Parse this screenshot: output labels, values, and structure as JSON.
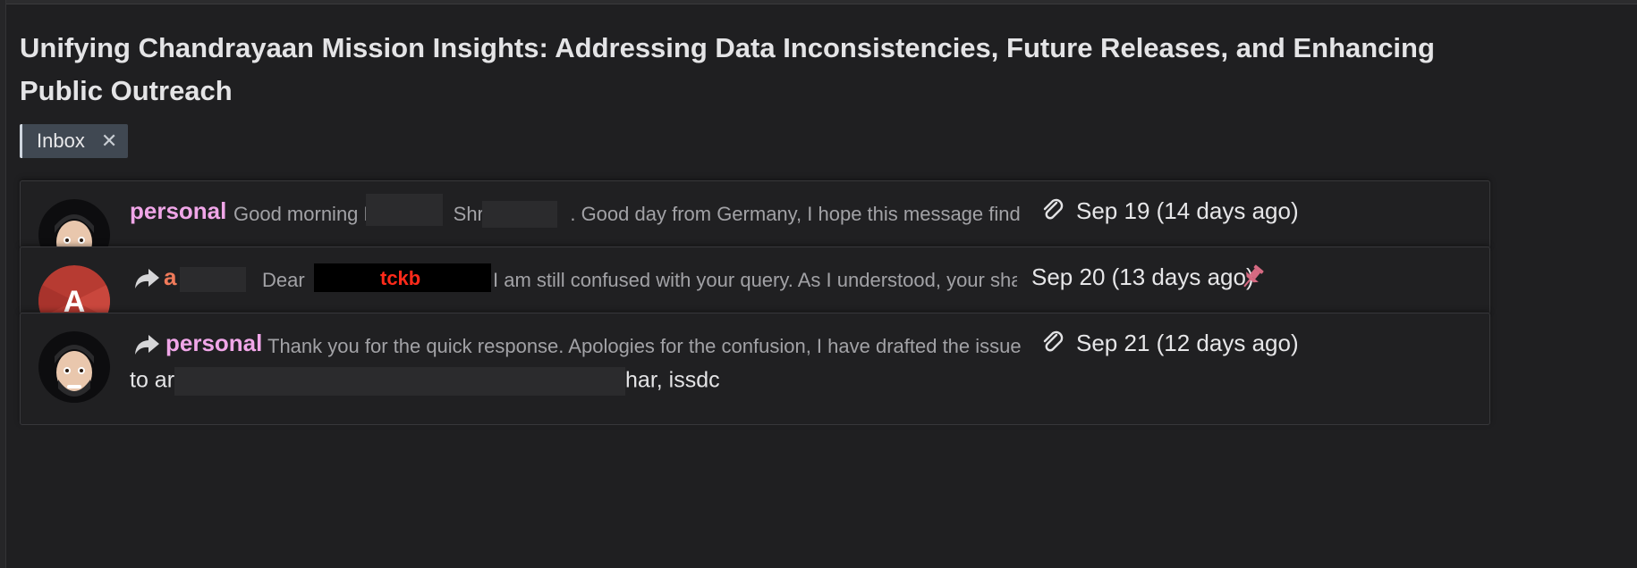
{
  "thread": {
    "title": "Unifying Chandrayaan Mission Insights: Addressing Data Inconsistencies, Future Releases, and Enhancing Public Outreach",
    "labels": [
      {
        "name": "Inbox",
        "remove_icon": "close-icon"
      }
    ]
  },
  "messages": [
    {
      "sender": "personal",
      "snippet": "Good morning Dr. Arya & Shri A      . Good day from Germany, I hope this message finds you",
      "snippet_part1": "Good morning Dr.",
      "snippet_part2": "Shri A",
      "snippet_part3": ". Good day from Germany, I hope this message finds you",
      "has_attachment": true,
      "date": "Sep 19 (14 days ago)"
    },
    {
      "sender": "a",
      "avatar_letter": "A",
      "forwarded": true,
      "snippet_prefix": "Dear",
      "redaction_text": "tckb",
      "snippet_rest": "I am still confused with your query. As I understood, your shape",
      "date": "Sep 20 (13 days ago)",
      "pinned": true
    },
    {
      "sender": "personal",
      "forwarded": true,
      "snippet": "Thank you for the quick response. Apologies for the confusion, I have drafted the issues I h",
      "has_attachment": true,
      "date": "Sep 21 (12 days ago)",
      "to_prefix": "to ar",
      "to_suffix": "har, issdc"
    }
  ],
  "colors": {
    "background": "#1f1f21",
    "sender_personal": "#f0a6e8",
    "sender_a": "#f07a5a",
    "chip": "#404852",
    "pin": "#d66a82",
    "redaction_text": "#ff2a1a"
  }
}
